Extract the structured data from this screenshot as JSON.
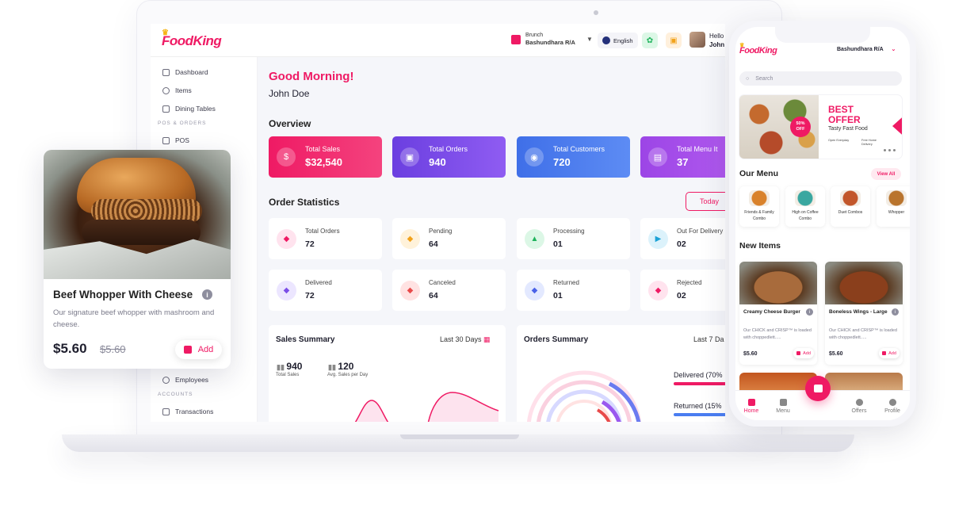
{
  "brand": {
    "name": "FoodKing",
    "crown_icon": "crown-icon",
    "accent": "#ef1a64"
  },
  "topbar": {
    "branch_label": "Brunch",
    "branch_name": "Bashundhara R/A",
    "language": "English",
    "hello": "Hello",
    "user_first": "John"
  },
  "sidebar": {
    "items": [
      {
        "label": "Dashboard",
        "icon": "grid-icon"
      },
      {
        "label": "Items",
        "icon": "items-icon"
      },
      {
        "label": "Dining Tables",
        "icon": "table-icon"
      }
    ],
    "section_pos": "POS & ORDERS",
    "pos": "POS",
    "employees": "Employees",
    "section_accounts": "ACCOUNTS",
    "transactions": "Transactions"
  },
  "main": {
    "greeting": "Good Morning!",
    "user": "John Doe",
    "overview_title": "Overview",
    "overview": [
      {
        "label": "Total Sales",
        "value": "$32,540",
        "color": "#ef1a64"
      },
      {
        "label": "Total Orders",
        "value": "940",
        "color": "#7b4de8"
      },
      {
        "label": "Total Customers",
        "value": "720",
        "color": "#4a7df1"
      },
      {
        "label": "Total Menu It",
        "value": "37",
        "color": "#9c45e6"
      }
    ],
    "order_stats_title": "Order Statistics",
    "today": "Today",
    "stats": [
      {
        "label": "Total Orders",
        "value": "72",
        "color": "#ffe3ee",
        "icon_color": "#ef1a64"
      },
      {
        "label": "Pending",
        "value": "64",
        "color": "#fff2da",
        "icon_color": "#f2a21a"
      },
      {
        "label": "Processing",
        "value": "01",
        "color": "#dcf7e6",
        "icon_color": "#1fb35c"
      },
      {
        "label": "Out For Delivery",
        "value": "02",
        "color": "#dcf2fb",
        "icon_color": "#1ba2d6"
      },
      {
        "label": "Delivered",
        "value": "72",
        "color": "#ece6ff",
        "icon_color": "#7b4de8"
      },
      {
        "label": "Canceled",
        "value": "64",
        "color": "#ffe2e2",
        "icon_color": "#e84a4a"
      },
      {
        "label": "Returned",
        "value": "01",
        "color": "#e3e9ff",
        "icon_color": "#4a62e8"
      },
      {
        "label": "Rejected",
        "value": "02",
        "color": "#ffe3ee",
        "icon_color": "#ef1a64"
      }
    ],
    "sales_summary": {
      "title": "Sales Summary",
      "range": "Last 30 Days",
      "total_sales_value": "940",
      "total_sales_label": "Total Sales",
      "avg_value": "120",
      "avg_label": "Avg. Sales per Day"
    },
    "orders_summary": {
      "title": "Orders Summary",
      "range": "Last 7 Da",
      "delivered": "Delivered (70%",
      "returned": "Returned (15%"
    }
  },
  "product_card": {
    "title": "Beef Whopper With Cheese",
    "description": "Our signature beef whopper with mashroom and cheese.",
    "price": "$5.60",
    "old_price": "$5.60",
    "add": "Add"
  },
  "phone": {
    "branch": "Bashundhara R/A",
    "search_placeholder": "Search",
    "banner": {
      "best": "BEST",
      "offer": "OFFER",
      "subtitle": "Tasty Fast Food",
      "discount_top": "50%",
      "discount_bottom": "OFF",
      "open_everyday": "Open Everyday",
      "free_home": "Free Home",
      "delivery": "Delivery"
    },
    "our_menu": "Our Menu",
    "view_all": "View All",
    "menu": [
      {
        "label": "Friends & Family Combo",
        "color": "#d9822b"
      },
      {
        "label": "High on Coffee Combo",
        "color": "#3aa7a0"
      },
      {
        "label": "Duet Combos",
        "color": "#c2562a"
      },
      {
        "label": "Whopper",
        "color": "#b9742d"
      }
    ],
    "new_items": "New Items",
    "items": [
      {
        "name": "Creamy Cheese Burger",
        "desc": "Our CHICK and CRISP™ is loaded with choppedlett.....",
        "price": "$5.60",
        "add": "Add",
        "color": "#a86b3c"
      },
      {
        "name": "Boneless Wings - Large",
        "desc": "Our CHICK and CRISP™ is loaded with choppedlett.....",
        "price": "$5.60",
        "add": "Add",
        "color": "#8a3f1c"
      }
    ],
    "tabs": [
      "Home",
      "Menu",
      "Offers",
      "Profile"
    ]
  }
}
